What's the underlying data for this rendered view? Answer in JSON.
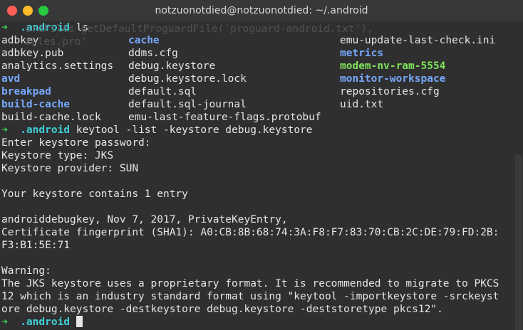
{
  "window": {
    "title": "notzuonotdied@notzuonotdied: ~/.android"
  },
  "ghost_text": {
    "line1": "ardFiles getDefaultProguardFile('proguard-android.txt'),",
    "line2": "rules.pro'"
  },
  "prompt": {
    "arrow": "➜",
    "dir": ".android"
  },
  "cmd1": "ls",
  "ls": {
    "col1": [
      {
        "t": "adbkey",
        "k": "file"
      },
      {
        "t": "adbkey.pub",
        "k": "file"
      },
      {
        "t": "analytics.settings",
        "k": "file"
      },
      {
        "t": "avd",
        "k": "dir"
      },
      {
        "t": "breakpad",
        "k": "dir"
      },
      {
        "t": "build-cache",
        "k": "dir"
      },
      {
        "t": "build-cache.lock",
        "k": "file"
      }
    ],
    "col2": [
      {
        "t": "cache",
        "k": "dir"
      },
      {
        "t": "ddms.cfg",
        "k": "file"
      },
      {
        "t": "debug.keystore",
        "k": "file"
      },
      {
        "t": "debug.keystore.lock",
        "k": "file"
      },
      {
        "t": "default.sql",
        "k": "file"
      },
      {
        "t": "default.sql-journal",
        "k": "file"
      },
      {
        "t": "emu-last-feature-flags.protobuf",
        "k": "file"
      }
    ],
    "col3": [
      {
        "t": "emu-update-last-check.ini",
        "k": "file"
      },
      {
        "t": "metrics",
        "k": "dir"
      },
      {
        "t": "modem-nv-ram-5554",
        "k": "exe"
      },
      {
        "t": "monitor-workspace",
        "k": "dir"
      },
      {
        "t": "repositories.cfg",
        "k": "file"
      },
      {
        "t": "uid.txt",
        "k": "file"
      }
    ]
  },
  "cmd2": "keytool -list -keystore debug.keystore",
  "output": [
    "Enter keystore password:",
    "Keystore type: JKS",
    "Keystore provider: SUN",
    "",
    "Your keystore contains 1 entry",
    "",
    "androiddebugkey, Nov 7, 2017, PrivateKeyEntry,",
    "Certificate fingerprint (SHA1): A0:CB:8B:68:74:3A:F8:F7:83:70:CB:2C:DE:79:FD:2B:",
    "F3:B1:5E:71",
    "",
    "Warning:",
    "The JKS keystore uses a proprietary format. It is recommended to migrate to PKCS",
    "12 which is an industry standard format using \"keytool -importkeystore -srckeyst",
    "ore debug.keystore -destkeystore debug.keystore -deststoretype pkcs12\"."
  ]
}
